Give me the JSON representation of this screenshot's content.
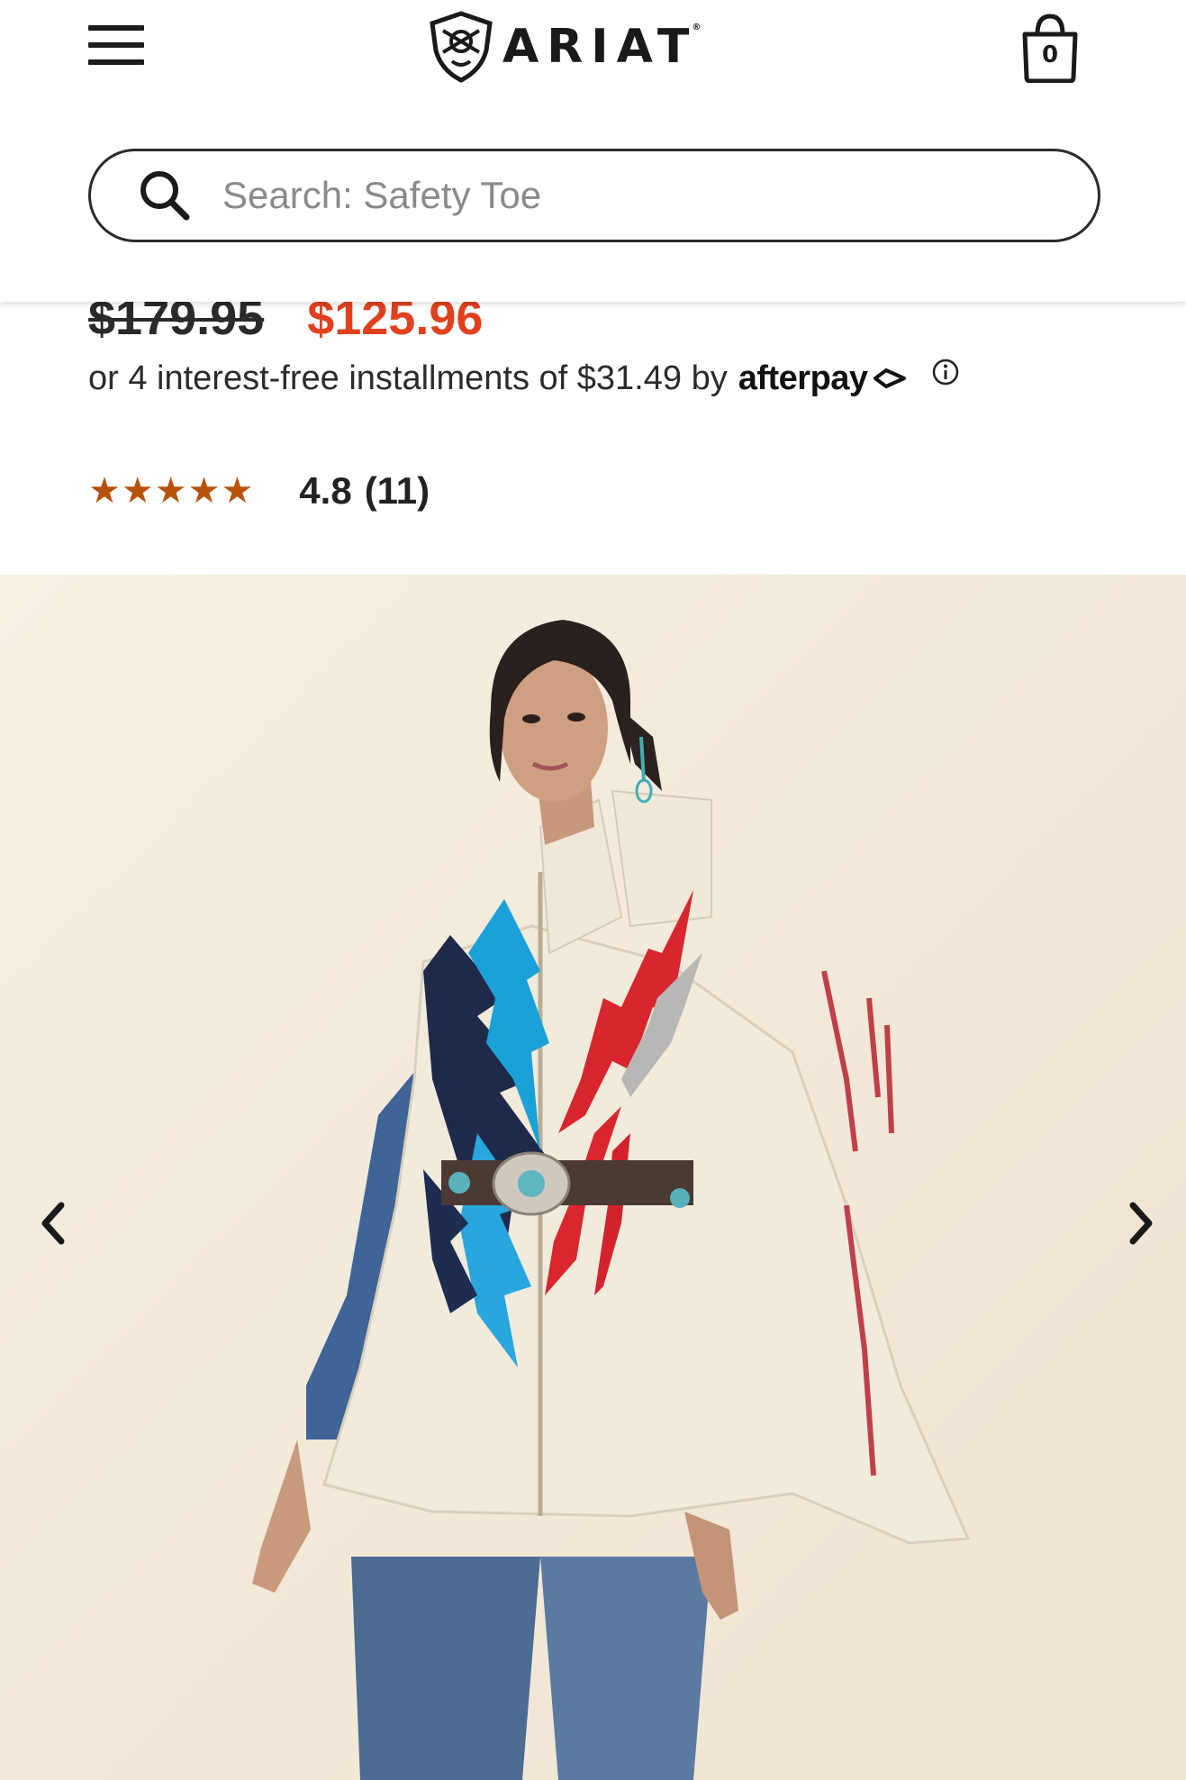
{
  "header": {
    "brand": "ARIAT",
    "brand_mark": "®",
    "cart_count": "0",
    "icons": {
      "menu": "hamburger-menu-icon",
      "cart": "shopping-bag-icon",
      "search": "search-icon"
    }
  },
  "search": {
    "placeholder": "Search: Safety Toe",
    "value": ""
  },
  "product": {
    "price_original": "$179.95",
    "price_sale": "$125.96",
    "installments_text": "or 4 interest-free installments of $31.49 by",
    "afterpay_label": "afterpay",
    "rating_stars": "★★★★★",
    "rating_value": "4.8",
    "rating_count": "(11)"
  },
  "colors": {
    "sale_price": "#e0401e",
    "stars": "#b8520a",
    "text": "#222222"
  },
  "gallery": {
    "image": "woman-wearing-cream-aztec-cape",
    "prev": "chevron-left-icon",
    "next": "chevron-right-icon"
  }
}
